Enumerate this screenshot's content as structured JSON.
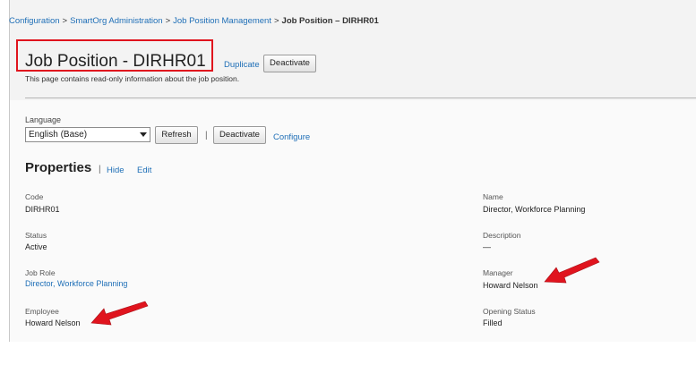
{
  "breadcrumb": {
    "items": [
      "Configuration",
      "SmartOrg Administration",
      "Job Position Management"
    ],
    "separator": ">",
    "current": "Job Position – DIRHR01"
  },
  "header": {
    "title": "Job Position - DIRHR01",
    "duplicate_label": "Duplicate",
    "deactivate_label": "Deactivate",
    "subtitle": "This page contains read-only information about the job position."
  },
  "language": {
    "label": "Language",
    "selected": "English (Base)",
    "refresh_label": "Refresh",
    "separator": "|",
    "deactivate_label": "Deactivate",
    "configure_label": "Configure"
  },
  "properties": {
    "title": "Properties",
    "separator": "|",
    "hide_label": "Hide",
    "edit_label": "Edit",
    "left_fields": [
      {
        "label": "Code",
        "value": "DIRHR01"
      },
      {
        "label": "Status",
        "value": "Active"
      },
      {
        "label": "Job Role",
        "value": "Director, Workforce Planning"
      },
      {
        "label": "Employee",
        "value": "Howard Nelson"
      }
    ],
    "right_fields": [
      {
        "label": "Name",
        "value": "Director, Workforce Planning"
      },
      {
        "label": "Description",
        "value": "—"
      },
      {
        "label": "Manager",
        "value": "Howard Nelson"
      },
      {
        "label": "Opening Status",
        "value": "Filled"
      }
    ]
  },
  "colors": {
    "link": "#1f6fb7",
    "highlight_box": "#e0141e",
    "annotation_arrow": "#e0141e"
  }
}
